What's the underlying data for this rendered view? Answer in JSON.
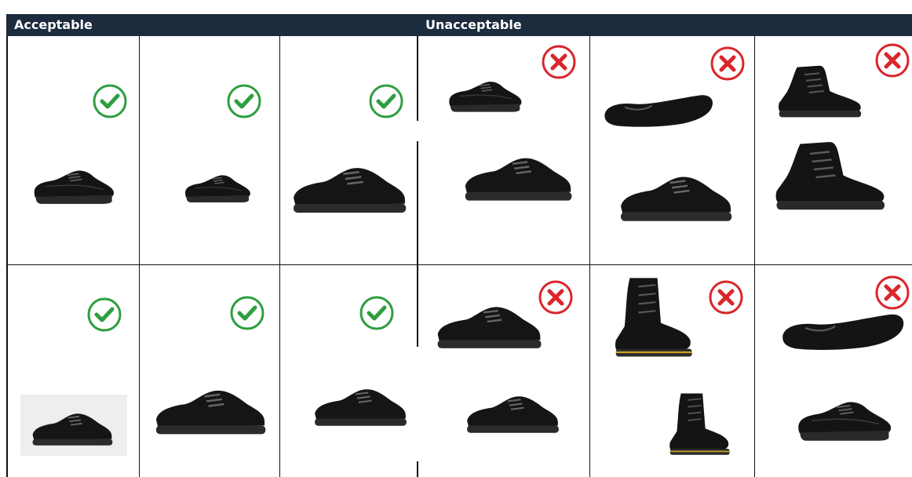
{
  "headers": {
    "acceptable": "Acceptable",
    "unacceptable": "Unacceptable"
  },
  "colors": {
    "header_bg": "#1c2b3d",
    "header_text": "#ffffff",
    "accept_green": "#2e9e3f",
    "reject_red": "#d9262c",
    "shoe_black": "#141414",
    "grid": "#111111"
  },
  "rows": [
    {
      "acceptable": [
        {
          "status": "acceptable",
          "icon": "check-icon",
          "shoes": [
            "black-leather-lace-up-shoe"
          ]
        },
        {
          "status": "acceptable",
          "icon": "check-icon",
          "shoes": [
            "black-leather-oxford-shoe"
          ]
        },
        {
          "status": "acceptable",
          "icon": "check-icon",
          "shoes": [
            "black-leather-sneaker"
          ]
        }
      ],
      "unacceptable": [
        {
          "status": "unacceptable",
          "icon": "cross-icon",
          "shoes": [
            "black-canvas-plimsoll",
            "black-low-top-sneaker"
          ]
        },
        {
          "status": "unacceptable",
          "icon": "cross-icon",
          "shoes": [
            "black-ballet-flat",
            "black-slip-on-shoe"
          ]
        },
        {
          "status": "unacceptable",
          "icon": "cross-icon",
          "shoes": [
            "black-high-top-canvas-sneaker",
            "black-high-top-basketball-shoe"
          ]
        }
      ]
    },
    {
      "acceptable": [
        {
          "status": "acceptable",
          "icon": "check-icon",
          "shoes": [
            "black-leather-skate-shoe"
          ]
        },
        {
          "status": "acceptable",
          "icon": "check-icon",
          "shoes": [
            "black-leather-running-shoe"
          ]
        },
        {
          "status": "acceptable",
          "icon": "check-icon",
          "shoes": [
            "black-athletic-trainer"
          ]
        }
      ],
      "unacceptable": [
        {
          "status": "unacceptable",
          "icon": "cross-icon",
          "shoes": [
            "black-knit-sneakers",
            "black-nike-air-max-sneakers"
          ]
        },
        {
          "status": "unacceptable",
          "icon": "cross-icon",
          "shoes": [
            "black-combat-boot",
            "black-chelsea-boot"
          ]
        },
        {
          "status": "unacceptable",
          "icon": "cross-icon",
          "shoes": [
            "black-mary-jane-shoe",
            "black-t-bar-shoe"
          ]
        }
      ]
    }
  ]
}
